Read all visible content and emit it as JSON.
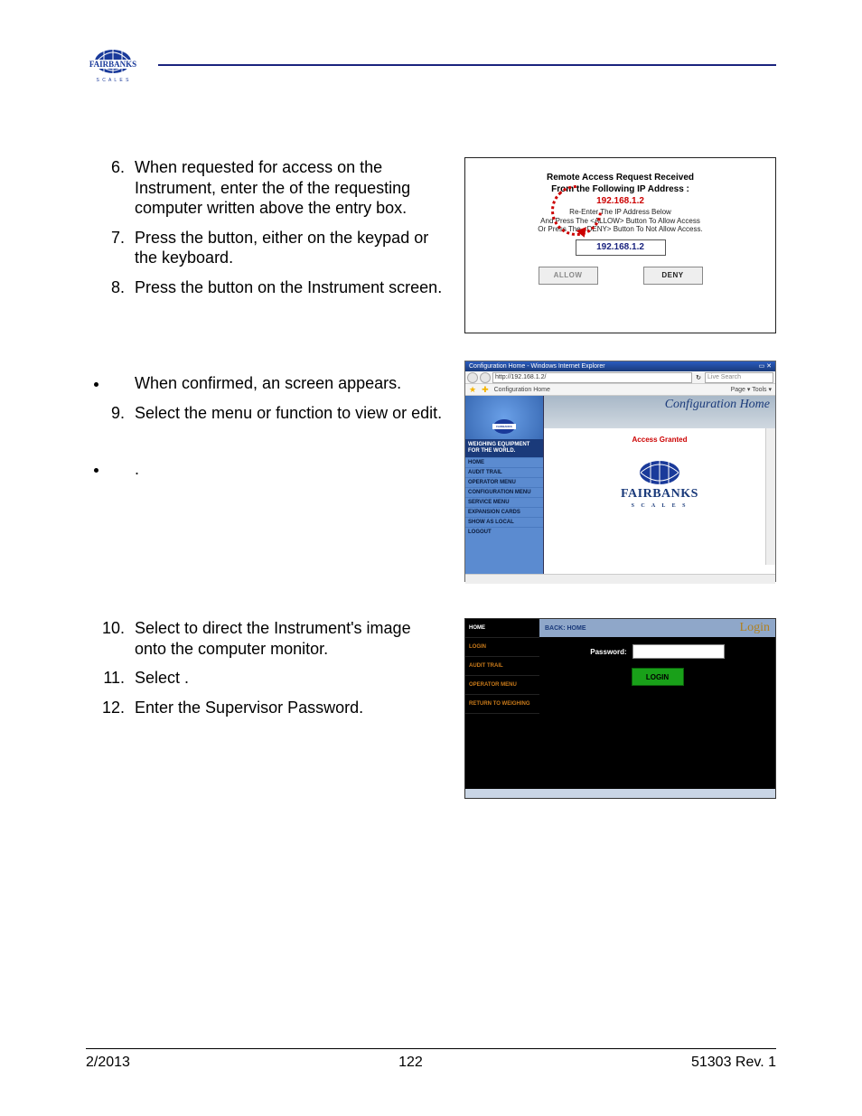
{
  "brand": "FAIRBANKS",
  "steps_a": {
    "start": 6,
    "items": [
      "When requested for access on the Instrument, enter the                      of the requesting computer written above the entry box.",
      "Press the              button, either on the keypad or the keyboard.",
      "Press the                button on the Instrument screen."
    ]
  },
  "bullets_a": [
    "When confirmed, an                              screen appears."
  ],
  "steps_b": {
    "start": 9,
    "items": [
      "Select the menu or function to view or edit."
    ]
  },
  "bullets_b": [
    "                                             ."
  ],
  "steps_c": {
    "start": 10,
    "items": [
      "Select                                      to direct the Instrument's image onto the computer monitor.",
      "Select               .",
      "Enter the Supervisor Password."
    ]
  },
  "fig1": {
    "title1": "Remote Access Request Received",
    "title2": "From the Following IP Address :",
    "ip": "192.168.1.2",
    "info1": "Re-Enter The IP Address Below",
    "info2": "And Press The <ALLOW> Button To Allow Access",
    "info3": "Or Press The <DENY> Button To Not Allow Access.",
    "input_value": "192.168.1.2",
    "allow": "ALLOW",
    "deny": "DENY"
  },
  "fig2": {
    "window_title": "Configuration Home - Windows Internet Explorer",
    "url": "http://192.168.1.2/",
    "search_placeholder": "Live Search",
    "tab": "Configuration Home",
    "toolbar": "Page ▾  Tools ▾",
    "banner": "Configuration Home",
    "access_granted": "Access Granted",
    "tagline": "WEIGHING EQUIPMENT FOR THE WORLD.",
    "menu": [
      "HOME",
      "AUDIT TRAIL",
      "OPERATOR MENU",
      "CONFIGURATION MENU",
      "SERVICE MENU",
      "EXPANSION CARDS",
      "SHOW AS LOCAL",
      "LOGOUT"
    ],
    "logo_name": "FAIRBANKS",
    "logo_tag": "S C A L E S"
  },
  "fig3": {
    "menu": [
      "HOME",
      "LOGIN",
      "AUDIT TRAIL",
      "OPERATOR MENU",
      "RETURN TO WEIGHING"
    ],
    "back": "BACK: HOME",
    "title": "Login",
    "password_label": "Password:",
    "login_button": "LOGIN"
  },
  "footer": {
    "left": "2/2013",
    "center": "122",
    "right": "51303     Rev. 1"
  }
}
